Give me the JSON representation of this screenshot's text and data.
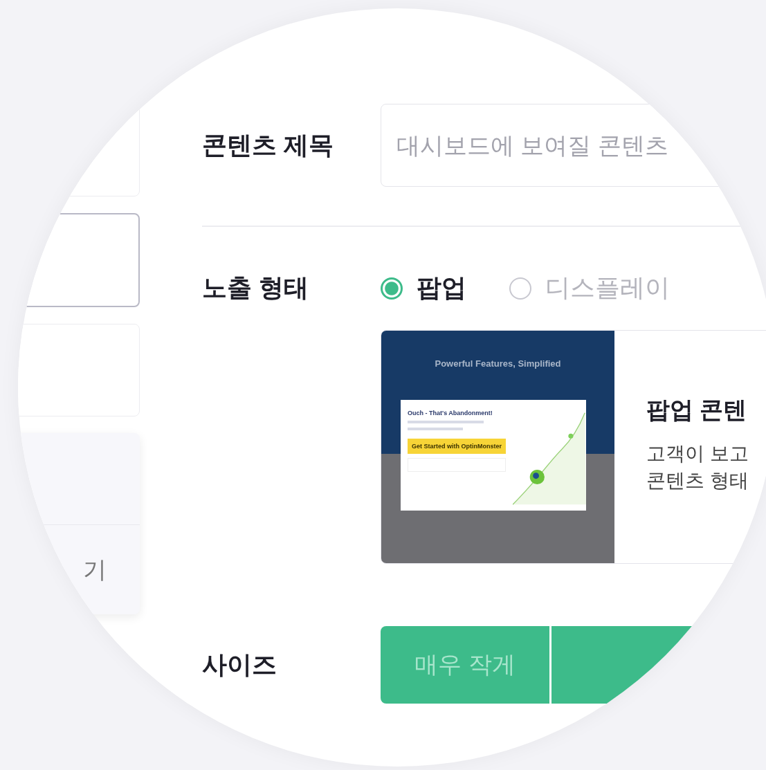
{
  "sidebar": {
    "cards": [
      {
        "selected": false
      },
      {
        "selected": true
      },
      {
        "selected": false
      }
    ],
    "panel_text": "기"
  },
  "title_field": {
    "label": "콘텐츠 제목",
    "placeholder": "대시보드에 보여질 콘텐츠"
  },
  "exposure": {
    "label": "노출 형태",
    "options": [
      {
        "label": "팝업",
        "selected": true
      },
      {
        "label": "디스플레이",
        "selected": false
      }
    ],
    "preview": {
      "headline": "Powerful Features, Simplified",
      "popup_title": "Ouch - That's Abandonment!",
      "popup_button": "Get Started with OptinMonster",
      "title": "팝업 콘텐",
      "description_lines": [
        "고객이 보고",
        "콘텐츠 형태"
      ]
    }
  },
  "size": {
    "label": "사이즈",
    "options": [
      {
        "label": "매우 작게"
      }
    ]
  }
}
